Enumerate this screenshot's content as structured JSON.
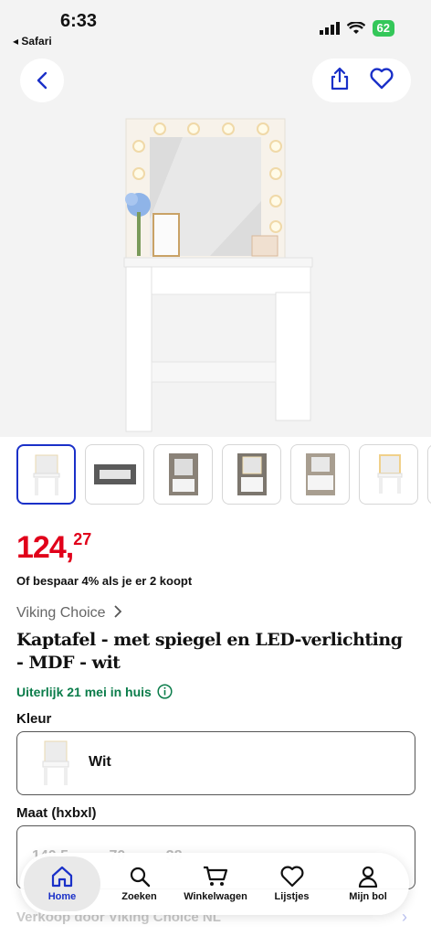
{
  "status": {
    "time": "6:33",
    "back_app": "◂ Safari",
    "battery": "62"
  },
  "product": {
    "price_main": "124,",
    "price_decimal": "27",
    "bundle_offer": "Of bespaar 4% als je er 2 koopt",
    "brand": "Viking Choice",
    "title": "Kaptafel - met spiegel en LED-verlichting - MDF - wit",
    "delivery": "Uiterlijk 21 mei in huis"
  },
  "options": {
    "color_label": "Kleur",
    "color_value": "Wit",
    "size_label": "Maat (hxbxl)",
    "size_value": "140,5 70 38"
  },
  "seller": "Verkoop door Viking Choice NL",
  "thumbnails": 7,
  "tabbar": {
    "items": [
      {
        "label": "Home",
        "icon": "home-icon",
        "active": true
      },
      {
        "label": "Zoeken",
        "icon": "search-icon",
        "active": false
      },
      {
        "label": "Winkelwagen",
        "icon": "cart-icon",
        "active": false
      },
      {
        "label": "Lijstjes",
        "icon": "heart-icon",
        "active": false
      },
      {
        "label": "Mijn bol",
        "icon": "user-icon",
        "active": false
      }
    ]
  },
  "colors": {
    "accent": "#1a30c8",
    "price": "#e1001a",
    "delivery": "#0a7c4a"
  }
}
